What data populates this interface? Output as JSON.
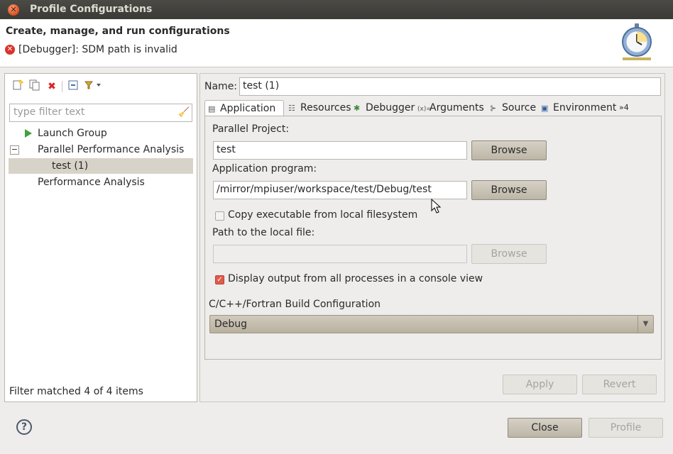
{
  "window": {
    "title": "Profile Configurations"
  },
  "header": {
    "heading": "Create, manage, and run configurations",
    "error": "[Debugger]: SDM path is invalid"
  },
  "left": {
    "filter_placeholder": "type filter text",
    "tree": [
      {
        "label": "Launch Group"
      },
      {
        "label": "Parallel Performance Analysis"
      },
      {
        "label": "test (1)"
      },
      {
        "label": "Performance Analysis"
      }
    ],
    "status": "Filter matched 4 of 4 items"
  },
  "config": {
    "name_label": "Name:",
    "name_value": "test (1)",
    "tabs": [
      {
        "label": "Application",
        "icon": "document-icon"
      },
      {
        "label": "Resources",
        "icon": "resources-icon"
      },
      {
        "label": "Debugger",
        "icon": "bug-icon"
      },
      {
        "label": "Arguments",
        "icon": "arguments-icon"
      },
      {
        "label": "Source",
        "icon": "source-icon"
      },
      {
        "label": "Environment",
        "icon": "environment-icon"
      }
    ],
    "more_tabs": "»4",
    "parallel_project_label": "Parallel Project:",
    "parallel_project_value": "test",
    "app_program_label": "Application program:",
    "app_program_value": "/mirror/mpiuser/workspace/test/Debug/test",
    "browse_label": "Browse",
    "copy_exec_label": "Copy executable from local filesystem",
    "copy_exec_checked": false,
    "local_path_label": "Path to the local file:",
    "local_path_value": "",
    "display_output_label": "Display output from all processes in a console view",
    "display_output_checked": true,
    "build_config_label": "C/C++/Fortran Build Configuration",
    "build_config_value": "Debug",
    "apply_label": "Apply",
    "revert_label": "Revert"
  },
  "footer": {
    "close_label": "Close",
    "profile_label": "Profile"
  }
}
